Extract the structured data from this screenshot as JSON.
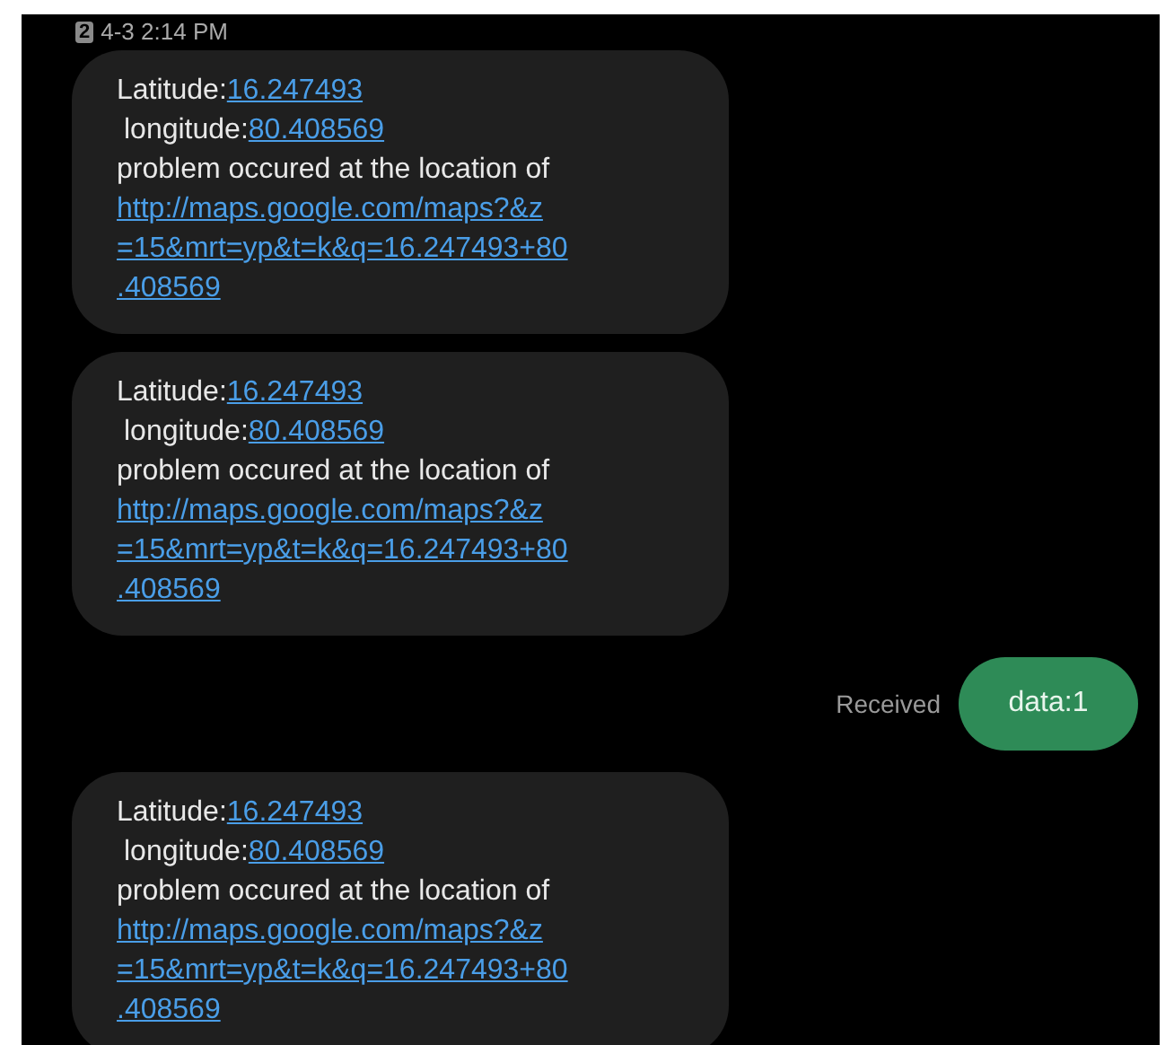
{
  "header": {
    "sim": "2",
    "timestamp": "4-3 2:14 PM"
  },
  "messages": [
    {
      "kind": "incoming",
      "latitude_label": "Latitude:",
      "latitude": "16.247493",
      "longitude_label": "longitude:",
      "longitude": "80.408569",
      "body": "problem occured at the location of",
      "url_lines": [
        "http://maps.google.com/maps?&z",
        "=15&mrt=yp&t=k&q=16.247493+80",
        ".408569"
      ]
    },
    {
      "kind": "incoming",
      "latitude_label": "Latitude:",
      "latitude": "16.247493",
      "longitude_label": "longitude:",
      "longitude": "80.408569",
      "body": "problem occured at the location of",
      "url_lines": [
        "http://maps.google.com/maps?&z",
        "=15&mrt=yp&t=k&q=16.247493+80",
        ".408569"
      ]
    },
    {
      "kind": "outgoing",
      "status": "Received",
      "text": "data:1"
    },
    {
      "kind": "incoming",
      "latitude_label": "Latitude:",
      "latitude": "16.247493",
      "longitude_label": "longitude:",
      "longitude": "80.408569",
      "body": "problem occured at the location of",
      "url_lines": [
        "http://maps.google.com/maps?&z",
        "=15&mrt=yp&t=k&q=16.247493+80",
        ".408569"
      ]
    }
  ]
}
